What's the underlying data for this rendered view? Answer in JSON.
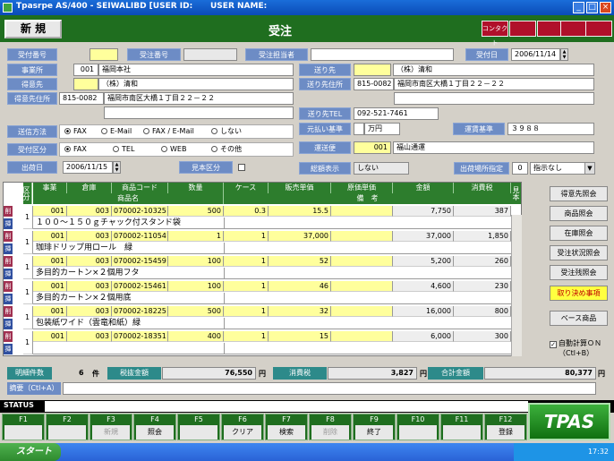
{
  "window": {
    "title": "Tpasrpe AS/400 - SEIWALIBD  [USER ID:",
    "username_label": "USER NAME:",
    "min": "_",
    "max": "□",
    "close": "×"
  },
  "header": {
    "mode": "新 規",
    "title": "受注",
    "red_buttons": [
      "コンタクト",
      "",
      "",
      "",
      ""
    ]
  },
  "form": {
    "order_no_label": "受付番号",
    "order_no": "",
    "recv_no_label": "受注番号",
    "recv_no": "",
    "staff_label": "受注担当者",
    "staff": "",
    "date_label": "受付日",
    "date": "2006/11/14",
    "office_label": "事業所",
    "office_code": "001",
    "office_name": "福岡本社",
    "customer_label": "得意先",
    "customer_code": "",
    "customer_name": "（株）清和",
    "cust_addr_label": "得意先住所",
    "cust_zip": "815-0082",
    "cust_addr": "福岡市南区大橋１丁目２２－２２",
    "cust_addr2": "",
    "ship_label": "送り先",
    "ship_code": "",
    "ship_name": "（株）清和",
    "ship_addr_label": "送り先住所",
    "ship_zip": "815-0082",
    "ship_addr": "福岡市南区大橋１丁目２２－２２",
    "ship_addr2": "",
    "ship_tel_label": "送り先TEL",
    "ship_tel": "092-521-7461",
    "pay_label": "元払い基準",
    "pay_value": "",
    "pay_unit": "万円",
    "freight_label": "運賃基準",
    "freight_value": "３９８８",
    "carrier_label": "運送便",
    "carrier_code": "001",
    "carrier_name": "福山通運",
    "send_method_label": "送信方法",
    "send_methods": [
      "FAX",
      "E-Mail",
      "FAX / E-Mail",
      "しない"
    ],
    "recv_type_label": "受付区分",
    "recv_types": [
      "FAX",
      "TEL",
      "WEB",
      "その他"
    ],
    "ship_date_label": "出荷日",
    "ship_date": "2006/11/15",
    "sample_label": "見本区分",
    "total_disp_label": "総額表示",
    "total_disp": "しない",
    "ship_place_label": "出荷場所指定",
    "ship_place_code": "0",
    "ship_place": "指示なし"
  },
  "grid": {
    "headers_top": [
      "区分",
      "事業",
      "倉庫",
      "商品コード",
      "数量",
      "ケース",
      "販売単価",
      "原価単価",
      "金額",
      "消費税",
      "見本"
    ],
    "headers_bottom": [
      "商品名",
      "備　考"
    ],
    "rows": [
      {
        "div": "1",
        "office": "001",
        "wh": "003",
        "code": "070002-10325",
        "qty": "500",
        "case": "0.3",
        "price": "15.5",
        "cost": "",
        "amount": "7,750",
        "tax": "387",
        "name": "１００～１５０ｇチャック付スタンド袋"
      },
      {
        "div": "1",
        "office": "001",
        "wh": "003",
        "code": "070002-11054",
        "qty": "1",
        "case": "1",
        "price": "37,000",
        "cost": "",
        "amount": "37,000",
        "tax": "1,850",
        "name": "珈琲ドリップ用ロール　緑"
      },
      {
        "div": "1",
        "office": "001",
        "wh": "003",
        "code": "070002-15459",
        "qty": "100",
        "case": "1",
        "price": "52",
        "cost": "",
        "amount": "5,200",
        "tax": "260",
        "name": "多目的カートン×２個用フタ"
      },
      {
        "div": "1",
        "office": "001",
        "wh": "003",
        "code": "070002-15461",
        "qty": "100",
        "case": "1",
        "price": "46",
        "cost": "",
        "amount": "4,600",
        "tax": "230",
        "name": "多目的カートン×２個用底"
      },
      {
        "div": "1",
        "office": "001",
        "wh": "003",
        "code": "070002-18225",
        "qty": "500",
        "case": "1",
        "price": "32",
        "cost": "",
        "amount": "16,000",
        "tax": "800",
        "name": "包装紙ワイド（雲竜和紙）緑"
      },
      {
        "div": "1",
        "office": "001",
        "wh": "003",
        "code": "070002-18351",
        "qty": "400",
        "case": "1",
        "price": "15",
        "cost": "",
        "amount": "6,000",
        "tax": "300",
        "name": ""
      }
    ],
    "del_label": "削",
    "ins_label": "挿"
  },
  "side_buttons": [
    "得意先照会",
    "商品照会",
    "在庫照会",
    "受注状況照会",
    "受注残照会",
    "取り決め事項",
    "ベース商品"
  ],
  "auto_calc": {
    "label": "自動計算ＯＮ",
    "sub": "（Ctl+B）"
  },
  "totals": {
    "count_label": "明細件数",
    "count": "6",
    "count_unit": "件",
    "pre_tax_label": "税抜金額",
    "pre_tax": "76,550",
    "tax_label": "消費税",
    "tax": "3,827",
    "total_label": "合計金額",
    "total": "80,377",
    "yen": "円",
    "memo_label": "摘要（Ctl+A）",
    "memo": ""
  },
  "status": {
    "label": "STATUS",
    "text": ""
  },
  "fkeys": [
    {
      "k": "F1",
      "v": ""
    },
    {
      "k": "F2",
      "v": ""
    },
    {
      "k": "F3",
      "v": "新規"
    },
    {
      "k": "F4",
      "v": "照会"
    },
    {
      "k": "F5",
      "v": ""
    },
    {
      "k": "F6",
      "v": "クリア"
    },
    {
      "k": "F7",
      "v": "検索"
    },
    {
      "k": "F8",
      "v": "削除"
    },
    {
      "k": "F9",
      "v": "終了"
    },
    {
      "k": "F10",
      "v": ""
    },
    {
      "k": "F11",
      "v": ""
    },
    {
      "k": "F12",
      "v": "登録"
    }
  ],
  "logo": "TPAS",
  "taskbar": {
    "start": "スタート",
    "clock": "17:32"
  }
}
